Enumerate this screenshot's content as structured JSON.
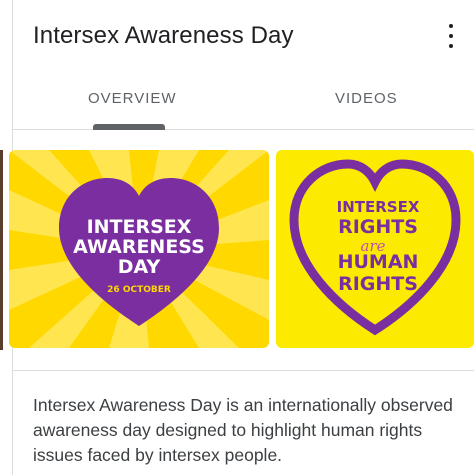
{
  "header": {
    "title": "Intersex Awareness Day",
    "menu_icon": "more-vert-icon"
  },
  "tabs": [
    {
      "label": "OVERVIEW",
      "selected": true
    },
    {
      "label": "VIDEOS",
      "selected": false
    }
  ],
  "images": [
    {
      "line1": "INTERSEX",
      "line2": "AWARENESS",
      "line3": "DAY",
      "date": "26 OCTOBER"
    },
    {
      "line1": "INTERSEX",
      "line2": "RIGHTS",
      "script": "are",
      "line3": "HUMAN",
      "line4": "RIGHTS"
    }
  ],
  "description": "Intersex Awareness Day is an internationally observed awareness day designed to highlight human rights issues faced by intersex people.",
  "colors": {
    "intersex_yellow": "#FFD800",
    "intersex_purple": "#7A2E9F",
    "light_yellow": "#FCEB00"
  }
}
